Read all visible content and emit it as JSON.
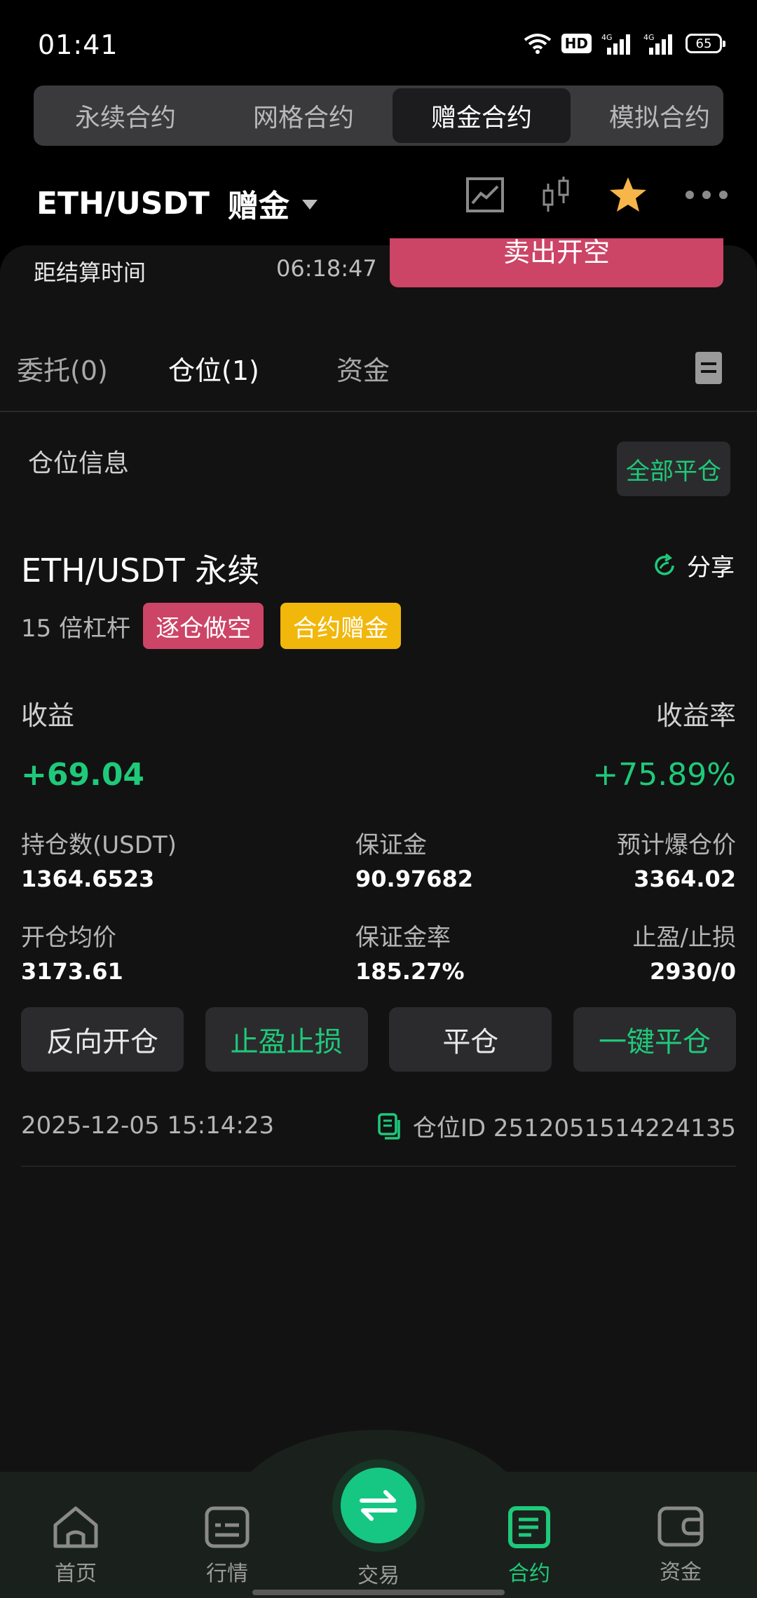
{
  "status_bar": {
    "time": "01:41",
    "hd_label": "HD",
    "net1": "4G",
    "net2": "4G",
    "battery": "65"
  },
  "mode_tabs": [
    {
      "label": "永续合约",
      "active": false
    },
    {
      "label": "网格合约",
      "active": false
    },
    {
      "label": "赠金合约",
      "active": true
    },
    {
      "label": "模拟合约",
      "active": false
    }
  ],
  "header": {
    "pair": "ETH/USDT",
    "sub": "赠金",
    "icons": [
      "chart-line-icon",
      "candlestick-icon",
      "star-icon",
      "more-icon"
    ]
  },
  "settlement": {
    "label": "距结算时间",
    "time": "06:18:47",
    "sell_button": "卖出开空"
  },
  "sub_tabs": [
    {
      "label": "委托(0)",
      "active": false
    },
    {
      "label": "仓位(1)",
      "active": true
    },
    {
      "label": "资金",
      "active": false
    }
  ],
  "position_section": {
    "title": "仓位信息",
    "close_all": "全部平仓"
  },
  "position": {
    "title": "ETH/USDT 永续",
    "share": "分享",
    "leverage": "15 倍杠杆",
    "badge_side": "逐仓做空",
    "badge_bonus": "合约赠金",
    "pnl_label": "收益",
    "pnl_rate_label": "收益率",
    "pnl": "+69.04",
    "pnl_rate": "+75.89%",
    "size_label": "持仓数(USDT)",
    "size": "1364.6523",
    "margin_label": "保证金",
    "margin": "90.97682",
    "liq_label": "预计爆仓价",
    "liq": "3364.02",
    "entry_label": "开仓均价",
    "entry": "3173.61",
    "margin_rate_label": "保证金率",
    "margin_rate": "185.27%",
    "tpsl_label": "止盈/止损",
    "tpsl": "2930/0",
    "actions": [
      "反向开仓",
      "止盈止损",
      "平仓",
      "一键平仓"
    ],
    "timestamp": "2025-12-05 15:14:23",
    "position_id": "仓位ID 2512051514224135"
  },
  "bottom_nav": [
    {
      "label": "首页",
      "active": false
    },
    {
      "label": "行情",
      "active": false
    },
    {
      "label": "交易",
      "active": false
    },
    {
      "label": "合约",
      "active": true
    },
    {
      "label": "资金",
      "active": false
    }
  ],
  "colors": {
    "green": "#1fc97a",
    "red": "#cc4466",
    "yellow": "#f2b70b"
  }
}
